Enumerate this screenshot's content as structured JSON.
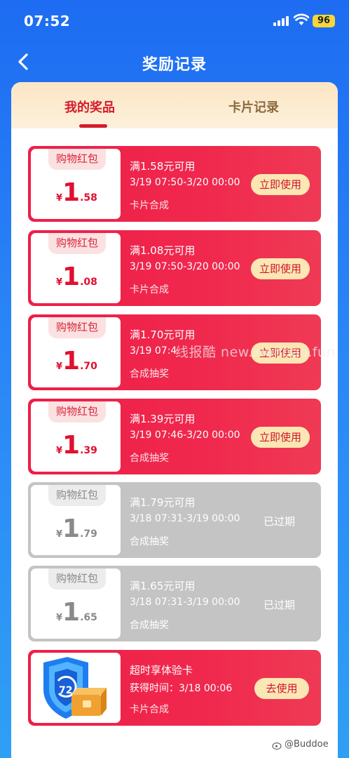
{
  "status_bar": {
    "time": "07:52",
    "battery": "96"
  },
  "nav": {
    "title": "奖励记录"
  },
  "tabs": [
    {
      "label": "我的奖品",
      "active": true
    },
    {
      "label": "卡片记录",
      "active": false
    }
  ],
  "cards": [
    {
      "type": "红包",
      "state": "active",
      "pill": "购物红包",
      "currency": "¥",
      "amount_int": "1",
      "amount_dec": ".58",
      "threshold": "满1.58元可用",
      "validity": "3/19 07:50-3/20 00:00",
      "source": "卡片合成",
      "action": "立即使用"
    },
    {
      "type": "红包",
      "state": "active",
      "pill": "购物红包",
      "currency": "¥",
      "amount_int": "1",
      "amount_dec": ".08",
      "threshold": "满1.08元可用",
      "validity": "3/19 07:50-3/20 00:00",
      "source": "卡片合成",
      "action": "立即使用"
    },
    {
      "type": "红包",
      "state": "active",
      "pill": "购物红包",
      "currency": "¥",
      "amount_int": "1",
      "amount_dec": ".70",
      "threshold": "满1.70元可用",
      "validity": "3/19 07:4",
      "source": "合成抽奖",
      "action": "立即使用"
    },
    {
      "type": "红包",
      "state": "active",
      "pill": "购物红包",
      "currency": "¥",
      "amount_int": "1",
      "amount_dec": ".39",
      "threshold": "满1.39元可用",
      "validity": "3/19 07:46-3/20 00:00",
      "source": "合成抽奖",
      "action": "立即使用"
    },
    {
      "type": "红包",
      "state": "expired",
      "pill": "购物红包",
      "currency": "¥",
      "amount_int": "1",
      "amount_dec": ".79",
      "threshold": "满1.79元可用",
      "validity": "3/18 07:31-3/19 00:00",
      "source": "合成抽奖",
      "action": "已过期"
    },
    {
      "type": "红包",
      "state": "expired",
      "pill": "购物红包",
      "currency": "¥",
      "amount_int": "1",
      "amount_dec": ".65",
      "threshold": "满1.65元可用",
      "validity": "3/18 07:31-3/19 00:00",
      "source": "合成抽奖",
      "action": "已过期"
    },
    {
      "type": "体验卡",
      "state": "active",
      "badge_number": "72",
      "threshold": "超时享体验卡",
      "validity": "获得时间：3/18 00:06",
      "source": "卡片合成",
      "action": "去使用"
    }
  ],
  "watermark": "线报酷 new.xianbao.fun",
  "credit": "@Buddoe",
  "colors": {
    "accent": "#ee1e48",
    "brand_blue": "#1d6cf2",
    "button_bg": "#fbe7b4",
    "expired_gray": "#c4c4c4"
  }
}
